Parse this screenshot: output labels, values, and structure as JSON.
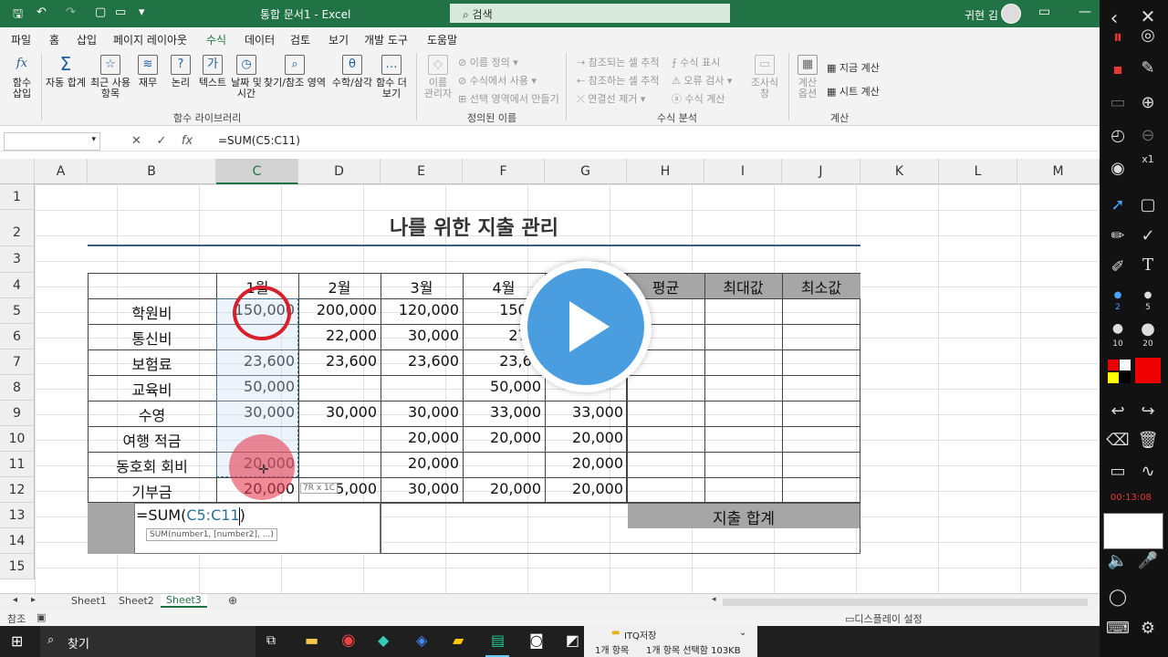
{
  "titlebar": {
    "title": "통합 문서1  -  Excel",
    "search_placeholder": "검색",
    "user_name": "귀현 김"
  },
  "menu": [
    "파일",
    "홈",
    "삽입",
    "페이지 레이아웃",
    "수식",
    "데이터",
    "검토",
    "보기",
    "개발 도구",
    "도움말"
  ],
  "active_menu": "수식",
  "ribbon": {
    "insert_function": "함수\n삽입",
    "autosum": "자동 합계",
    "recent": "최근 사용\n항목",
    "financial": "재무",
    "logical": "논리",
    "text": "텍스트",
    "datetime": "날짜 및\n시간",
    "lookup": "찾기/참조 영역",
    "math": "수학/삼각",
    "more": "함수 더\n보기",
    "group_functions": "함수 라이브러리",
    "name_manager": "이름\n관리자",
    "define_name": "이름 정의",
    "use_in_formula": "수식에서 사용",
    "create_from_sel": "선택 영역에서 만들기",
    "group_names": "정의된 이름",
    "trace_precedents": "참조되는 셀 추적",
    "trace_dependents": "참조하는 셀 추적",
    "remove_arrows": "연결선 제거",
    "show_formulas": "수식 표시",
    "error_check": "오류 검사",
    "evaluate": "수식 계산",
    "watch": "조사식\n창",
    "group_audit": "수식 분석",
    "calc_options": "계산\n옵션",
    "calc_now": "지금 계산",
    "calc_sheet": "시트 계산",
    "group_calc": "계산"
  },
  "formula_bar": {
    "formula": "=SUM(C5:C11)"
  },
  "columns": [
    "A",
    "B",
    "C",
    "D",
    "E",
    "F",
    "G",
    "H",
    "I",
    "J",
    "K",
    "L",
    "M"
  ],
  "rows": [
    "1",
    "2",
    "3",
    "4",
    "5",
    "6",
    "7",
    "8",
    "9",
    "10",
    "11",
    "12",
    "13",
    "14",
    "15"
  ],
  "sheet": {
    "title": "나를 위한 지출 관리",
    "headers": [
      "1월",
      "2월",
      "3월",
      "4월"
    ],
    "summary_headers": [
      "평균",
      "최대값",
      "최소값"
    ],
    "row_labels": [
      "학원비",
      "통신비",
      "보험료",
      "교육비",
      "수영",
      "여행 적금",
      "동호회 회비",
      "기부금"
    ],
    "c_values": [
      "150,000",
      "",
      "23,600",
      "50,000",
      "30,000",
      "",
      "20,000",
      "20,000"
    ],
    "d_values": [
      "200,000",
      "22,000",
      "23,600",
      "",
      "30,000",
      "",
      "",
      "15,000"
    ],
    "e_values": [
      "120,000",
      "30,000",
      "23,600",
      "",
      "30,000",
      "20,000",
      "20,000",
      "30,000"
    ],
    "f_values": [
      "150,0",
      "27,0",
      "23,60",
      "50,000",
      "33,000",
      "20,000",
      "",
      "20,000"
    ],
    "g_values": [
      "",
      "",
      "",
      "",
      "33,000",
      "20,000",
      "20,000",
      "20,000"
    ],
    "total_label": "지출 합계",
    "editing_formula_prefix": "=SUM(",
    "editing_formula_ref": "C5:C11",
    "editing_formula_suffix": ")",
    "tooltip": "SUM(number1, [number2], ...)",
    "size_tip": "7R x 1C"
  },
  "sheet_tabs": [
    "Sheet1",
    "Sheet2",
    "Sheet3"
  ],
  "active_sheet": "Sheet3",
  "status": {
    "left": "참조",
    "display_settings": "디스플레이 설정"
  },
  "taskbar": {
    "search": "찾기",
    "explorer_title": "ITQ저장",
    "items_count": "1개 항목",
    "selected": "1개 항목 선택함 103KB"
  },
  "recorder": {
    "timer": "00:13:08",
    "zoom": "x1",
    "sizes": [
      "2",
      "5",
      "10",
      "20"
    ]
  }
}
